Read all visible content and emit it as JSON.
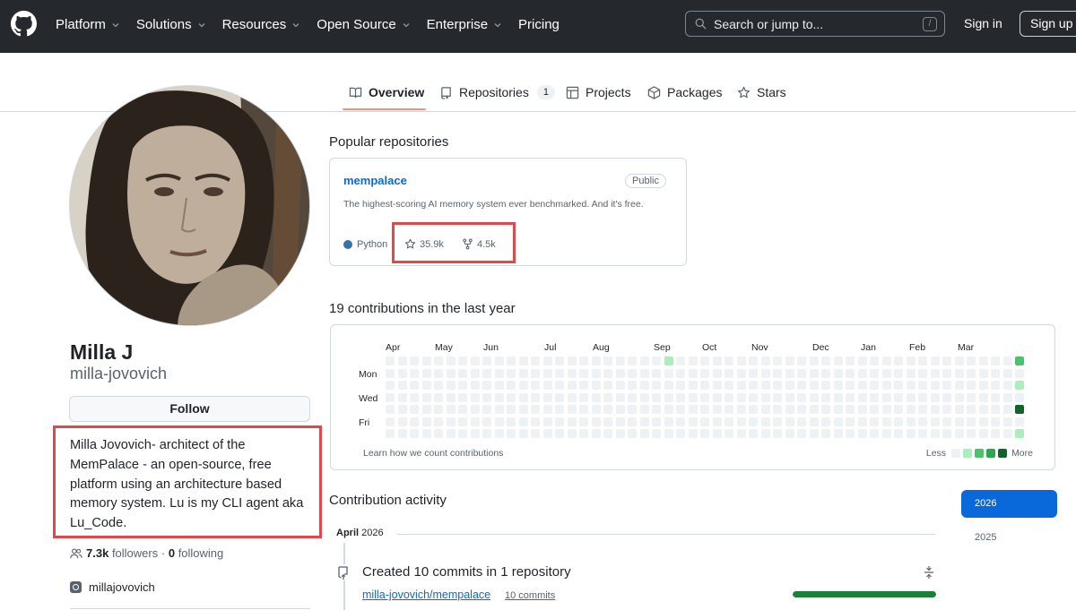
{
  "header": {
    "nav": [
      {
        "label": "Platform",
        "dropdown": true
      },
      {
        "label": "Solutions",
        "dropdown": true
      },
      {
        "label": "Resources",
        "dropdown": true
      },
      {
        "label": "Open Source",
        "dropdown": true
      },
      {
        "label": "Enterprise",
        "dropdown": true
      },
      {
        "label": "Pricing",
        "dropdown": false
      }
    ],
    "search_placeholder": "Search or jump to...",
    "search_shortcut": "/",
    "signin": "Sign in",
    "signup": "Sign up"
  },
  "tabs": [
    {
      "label": "Overview",
      "icon": "book-icon",
      "active": true
    },
    {
      "label": "Repositories",
      "icon": "repo-icon",
      "count": "1"
    },
    {
      "label": "Projects",
      "icon": "table-icon"
    },
    {
      "label": "Packages",
      "icon": "package-icon"
    },
    {
      "label": "Stars",
      "icon": "star-icon"
    }
  ],
  "profile": {
    "name": "Milla J",
    "login": "milla-jovovich",
    "follow": "Follow",
    "bio": "Milla Jovovich- architect of the MemPalace - an open-source, free platform using an architecture based memory system. Lu is my CLI agent aka Lu_Code.",
    "followers_count": "7.3k",
    "followers_label": "followers",
    "separator": "·",
    "following_count": "0",
    "following_label": "following",
    "social": "millajovovich"
  },
  "popular": {
    "title": "Popular repositories",
    "repos": [
      {
        "name": "mempalace",
        "visibility": "Public",
        "description": "The highest-scoring AI memory system ever benchmarked. And it's free.",
        "language": "Python",
        "language_color": "#3572A5",
        "stars": "35.9k",
        "forks": "4.5k"
      }
    ]
  },
  "contributions": {
    "title": "19 contributions in the last year",
    "months": [
      "Apr",
      "May",
      "Jun",
      "Jul",
      "Aug",
      "Sep",
      "Oct",
      "Nov",
      "Dec",
      "Jan",
      "Feb",
      "Mar"
    ],
    "days": [
      "Mon",
      "Wed",
      "Fri"
    ],
    "learn": "Learn how we count contributions",
    "less": "Less",
    "more": "More",
    "colors": [
      "#eff2f5",
      "#aceebb",
      "#4ac26b",
      "#2da44e",
      "#116329"
    ]
  },
  "activity": {
    "title": "Contribution activity",
    "month_name": "April",
    "month_year": "2026",
    "event_title": "Created 10 commits in 1 repository",
    "event_repo": "milla-jovovich/mempalace",
    "event_count": "10 commits",
    "event_share": 1.0,
    "years": [
      "2026",
      "2025"
    ]
  }
}
